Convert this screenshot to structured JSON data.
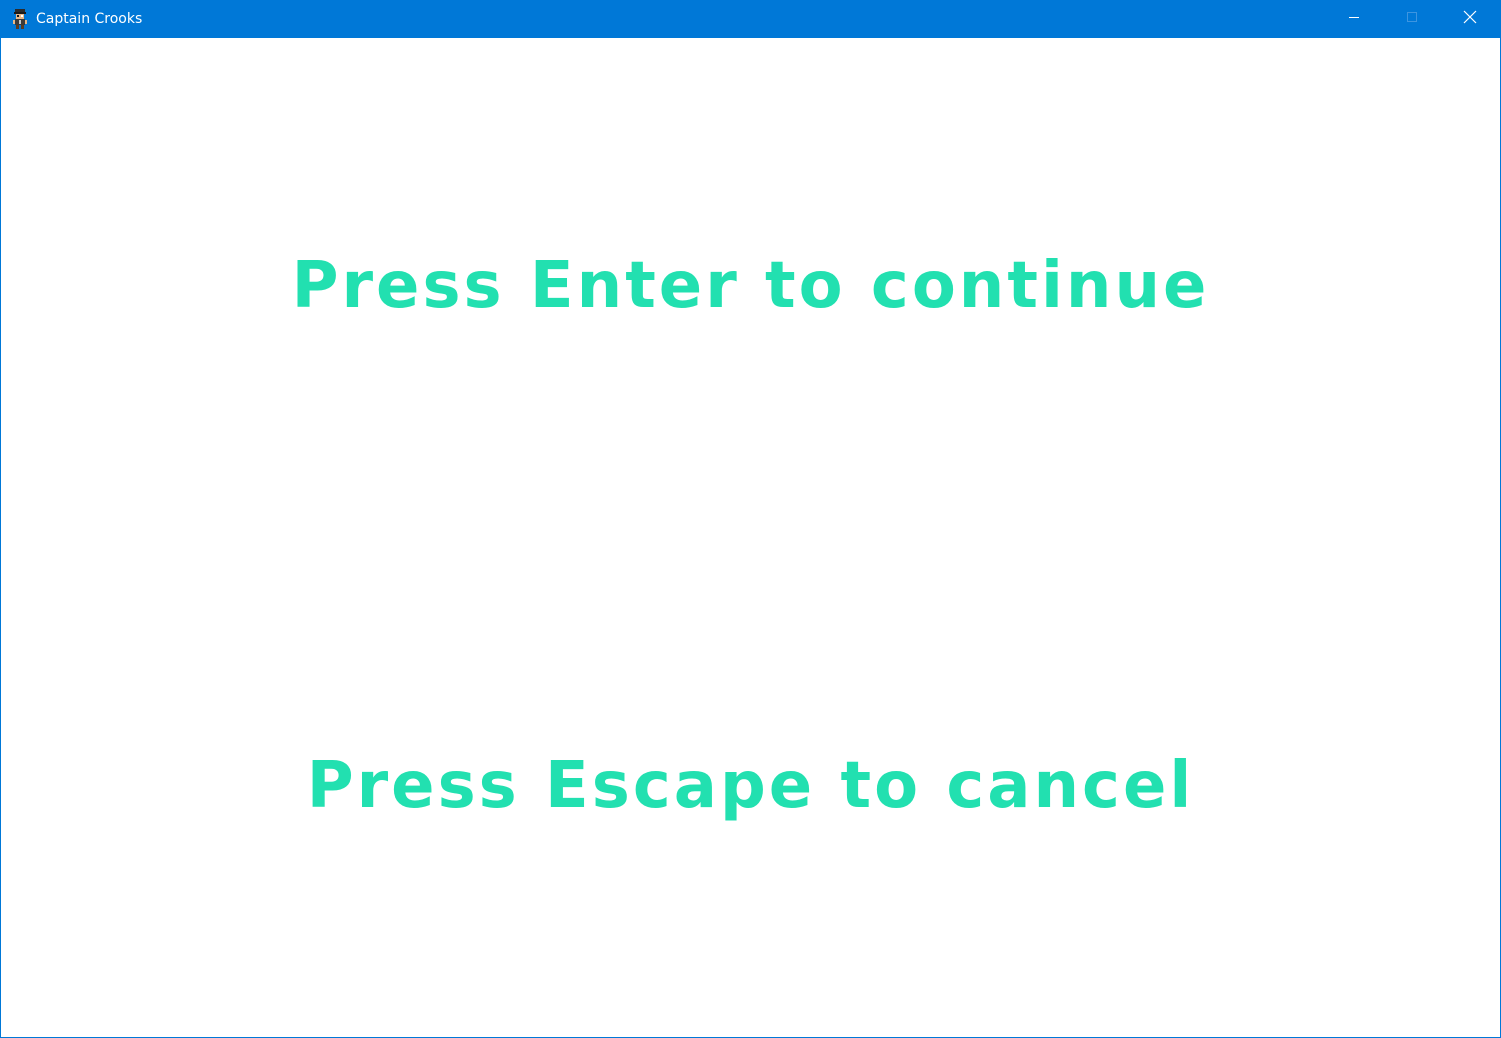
{
  "window": {
    "title": "Captain Crooks",
    "icon": "pirate-icon",
    "accent_color": "#0078d7",
    "controls": {
      "minimize_icon": "minimize-icon",
      "maximize_icon": "maximize-icon",
      "close_icon": "close-icon"
    }
  },
  "screen": {
    "text_color": "#22e0b0",
    "background_color": "#ffffff",
    "continue_prompt": "Press Enter to continue",
    "cancel_prompt": "Press Escape to cancel"
  }
}
